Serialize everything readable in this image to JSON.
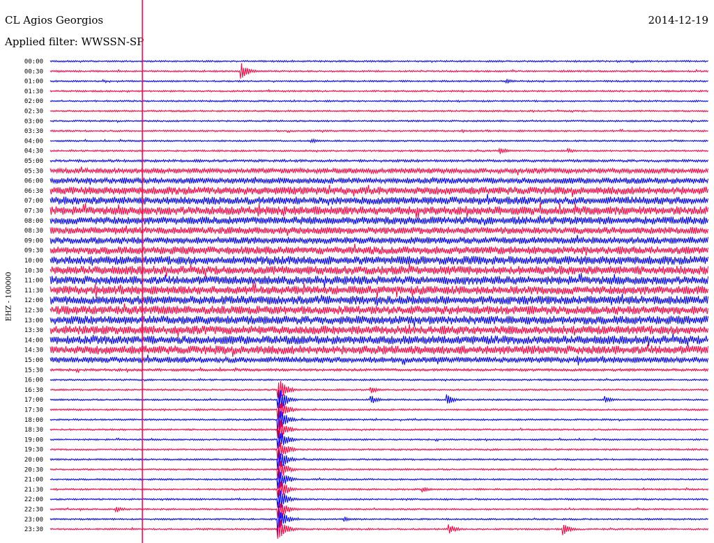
{
  "header": {
    "station": "CL Agios Georgios",
    "date": "2014-12-19",
    "filter_label": "Applied filter: WWSSN-SP"
  },
  "axis": {
    "ylabel": "EHZ - 100000"
  },
  "colors": {
    "trace_a": "#0000ff",
    "trace_b": "#ff0040",
    "marker": "#ff0040",
    "background": "#ffffff"
  },
  "chart_data": {
    "type": "line",
    "title": "CL Agios Georgios",
    "subtitle": "Applied filter: WWSSN-SP",
    "ylabel": "EHZ - 100000",
    "x_range_minutes": [
      0,
      30
    ],
    "series_colors_alternating": [
      "#0000ff",
      "#ff0040"
    ],
    "rows": [
      "00:00",
      "00:30",
      "01:00",
      "01:30",
      "02:00",
      "02:30",
      "03:00",
      "03:30",
      "04:00",
      "04:30",
      "05:00",
      "05:30",
      "06:00",
      "06:30",
      "07:00",
      "07:30",
      "08:00",
      "08:30",
      "09:00",
      "09:30",
      "10:00",
      "10:30",
      "11:00",
      "11:30",
      "12:00",
      "12:30",
      "13:00",
      "13:30",
      "14:00",
      "14:30",
      "15:00",
      "15:30",
      "16:00",
      "16:30",
      "17:00",
      "17:30",
      "18:00",
      "18:30",
      "19:00",
      "19:30",
      "20:00",
      "20:30",
      "21:00",
      "21:30",
      "22:00",
      "22:30",
      "23:00",
      "23:30"
    ],
    "noise_level": [
      2,
      2,
      2,
      2,
      2,
      2,
      2,
      2,
      2,
      2,
      3,
      6,
      7,
      9,
      9,
      10,
      9,
      8,
      8,
      9,
      10,
      10,
      10,
      10,
      10,
      10,
      10,
      10,
      10,
      10,
      7,
      3,
      2,
      2,
      2,
      2,
      2,
      2,
      2,
      2,
      2,
      2,
      2,
      2,
      2,
      2,
      2,
      2
    ],
    "events": [
      {
        "row": "00:30",
        "minute": 8.7,
        "amplitude": 26
      },
      {
        "row": "01:00",
        "minute": 20.8,
        "amplitude": 8
      },
      {
        "row": "04:00",
        "minute": 11.9,
        "amplitude": 8
      },
      {
        "row": "04:30",
        "minute": 20.5,
        "amplitude": 10
      },
      {
        "row": "04:30",
        "minute": 23.6,
        "amplitude": 7
      },
      {
        "row": "13:30",
        "minute": 4.2,
        "amplitude": 20
      },
      {
        "row": "16:30",
        "minute": 14.6,
        "amplitude": 12
      },
      {
        "row": "17:00",
        "minute": 14.6,
        "amplitude": 14
      },
      {
        "row": "17:00",
        "minute": 18.1,
        "amplitude": 14
      },
      {
        "row": "17:00",
        "minute": 25.3,
        "amplitude": 10
      },
      {
        "row": "16:30",
        "minute": 10.4,
        "amplitude": 40
      },
      {
        "row": "17:00",
        "minute": 10.4,
        "amplitude": 40
      },
      {
        "row": "17:30",
        "minute": 10.4,
        "amplitude": 40
      },
      {
        "row": "18:00",
        "minute": 10.4,
        "amplitude": 40
      },
      {
        "row": "18:30",
        "minute": 10.4,
        "amplitude": 40
      },
      {
        "row": "19:00",
        "minute": 10.4,
        "amplitude": 40
      },
      {
        "row": "19:30",
        "minute": 10.4,
        "amplitude": 40
      },
      {
        "row": "20:00",
        "minute": 10.4,
        "amplitude": 40
      },
      {
        "row": "20:30",
        "minute": 10.4,
        "amplitude": 40
      },
      {
        "row": "21:00",
        "minute": 10.4,
        "amplitude": 40
      },
      {
        "row": "21:30",
        "minute": 10.4,
        "amplitude": 40
      },
      {
        "row": "22:00",
        "minute": 10.4,
        "amplitude": 40
      },
      {
        "row": "22:30",
        "minute": 10.4,
        "amplitude": 40
      },
      {
        "row": "23:00",
        "minute": 10.4,
        "amplitude": 40
      },
      {
        "row": "23:30",
        "minute": 10.4,
        "amplitude": 40
      },
      {
        "row": "22:30",
        "minute": 3.0,
        "amplitude": 10
      },
      {
        "row": "23:00",
        "minute": 13.4,
        "amplitude": 8
      },
      {
        "row": "23:30",
        "minute": 18.2,
        "amplitude": 14
      },
      {
        "row": "23:30",
        "minute": 23.4,
        "amplitude": 16
      },
      {
        "row": "21:30",
        "minute": 17.0,
        "amplitude": 8
      }
    ],
    "marker_minute": 4.2
  }
}
